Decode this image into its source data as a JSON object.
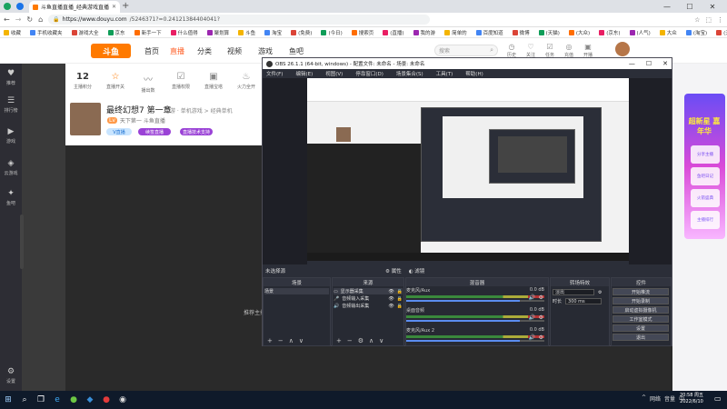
{
  "browser": {
    "tab_title": "斗鱼直播直播_经典游戏直播",
    "url_host": "https://www.douyu.com",
    "url_path": "/5246371?=0.24121384404041?",
    "bookmarks": [
      "收藏",
      "手机收藏夹",
      "游戏大全",
      "京东",
      "新手一下",
      "什么值得",
      "聚划算",
      "斗鱼",
      "淘宝",
      "(免费)",
      "(今日)",
      "搜索页",
      "(直播)",
      "我的游",
      "简单的",
      "百度知道",
      "微博",
      "(天猫)",
      "(大众)",
      "(京东)",
      "(人气)",
      "大众",
      "(淘宝)",
      "(天猫)",
      "(八八)",
      "(淘宝)",
      "淘宝",
      "(购)",
      "集中营"
    ]
  },
  "site": {
    "logo": "斗鱼",
    "nav": [
      "首页",
      "直播",
      "分类",
      "视频",
      "游戏",
      "鱼吧"
    ],
    "search_placeholder": "搜索",
    "header_icons": [
      {
        "icon": "history-icon",
        "label": "历史"
      },
      {
        "icon": "follow-icon",
        "label": "关注"
      },
      {
        "icon": "task-icon",
        "label": "任务"
      },
      {
        "icon": "recharge-icon",
        "label": "充值"
      },
      {
        "icon": "gift-icon",
        "label": "开播"
      }
    ]
  },
  "sidebar": [
    {
      "icon": "live-icon",
      "label": "推荐"
    },
    {
      "icon": "category-icon",
      "label": "排行榜"
    },
    {
      "icon": "video-icon",
      "label": "游戏"
    },
    {
      "icon": "game-icon",
      "label": "云游戏"
    },
    {
      "icon": "fish-icon",
      "label": "鱼吧"
    },
    {
      "icon": "settings-icon",
      "label": "设置"
    }
  ],
  "dashboard": {
    "stats": [
      {
        "value": "12",
        "label": "主播积分",
        "type": "number"
      },
      {
        "icon": "badge-icon",
        "label": "直播开关",
        "type": "icon"
      },
      {
        "icon": "wave-icon",
        "label": "播出数"
      },
      {
        "icon": "check-icon",
        "label": "直播权限"
      },
      {
        "icon": "ad-icon",
        "label": "直播宝塔"
      },
      {
        "icon": "fire-icon",
        "label": "火力全开"
      }
    ],
    "title": "最终幻想7 第一章",
    "category": "网游 · 单机游戏 > 经典单机",
    "streamer": "天下第一 斗鱼直播",
    "pills": [
      "V直播",
      "续签直播",
      "直播技术支持"
    ]
  },
  "right_ad": {
    "title": "超新星 嘉年华",
    "items": [
      "分享主播",
      "鱼吧日记",
      "火箭盛典",
      "主播排行"
    ]
  },
  "side_note": "推荐主播",
  "obs": {
    "title": "OBS 26.1.1 (64-bit, windows) - 配置文件: 未命名 - 场景: 未命名",
    "menu": [
      "文件(F)",
      "编辑(E)",
      "视图(V)",
      "停靠窗口(D)",
      "场景集合(S)",
      "工具(T)",
      "帮助(H)"
    ],
    "status_left": "未选择源",
    "status_btns": [
      "属性",
      "滤镜"
    ],
    "docks": {
      "scenes": {
        "title": "场景",
        "items": [
          "场景"
        ]
      },
      "sources": {
        "title": "来源",
        "items": [
          "显示器采集",
          "音频输入采集",
          "音频输出采集"
        ]
      },
      "mixer": {
        "title": "混音器",
        "channels": [
          {
            "name": "麦克风/Aux",
            "db": "0.0 dB",
            "level": 0.82
          },
          {
            "name": "桌面音频",
            "db": "0.0 dB",
            "level": 0.82
          },
          {
            "name": "麦克风/Aux 2",
            "db": "0.0 dB",
            "level": 0.82
          }
        ]
      },
      "transitions": {
        "title": "转场特效",
        "type": "淡出",
        "duration_label": "时长",
        "duration": "300 ms"
      },
      "controls": {
        "title": "控件",
        "buttons": [
          "开始推流",
          "开始录制",
          "启动虚拟摄像机",
          "工作室模式",
          "设置",
          "退出"
        ]
      }
    }
  },
  "taskbar": {
    "time": "20:58 周五",
    "date": "2022/6/10",
    "tray": [
      "^",
      "网络",
      "音量",
      "中"
    ]
  }
}
